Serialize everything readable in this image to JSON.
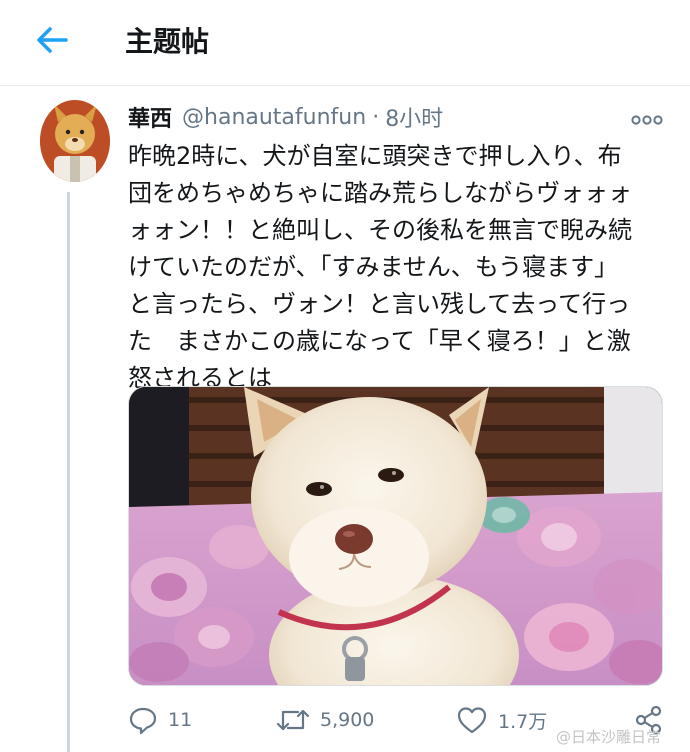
{
  "header": {
    "back_icon": "arrow-left-icon",
    "title": "主题帖",
    "accent_color": "#1da1f2"
  },
  "tweet": {
    "display_name": "華西",
    "handle": "@hanautafunfun",
    "separator": "·",
    "timestamp": "8小时",
    "more_icon": "more-horizontal-icon",
    "text_lines": [
      "昨晩2時に、犬が自室に頭突きで押し入り、布",
      "団をめちゃめちゃに踏み荒らしながらヴォォォ",
      "ォォン！！と絶叫し、その後私を無言で睨み続",
      "けていたのだが、「すみません、もう寝ます」",
      "と言ったら、ヴォン！と言い残して去って行っ",
      "た　まさかこの歳になって「早く寝ろ！」と激",
      "怒されるとは"
    ],
    "media_description_icon": "dog-photo"
  },
  "actions": {
    "reply": {
      "icon": "reply-icon",
      "count": "11"
    },
    "retweet": {
      "icon": "retweet-icon",
      "count": "5,900"
    },
    "like": {
      "icon": "heart-icon",
      "count": "1.7万"
    },
    "share": {
      "icon": "share-icon"
    }
  },
  "watermark": "@日本沙雕日常"
}
